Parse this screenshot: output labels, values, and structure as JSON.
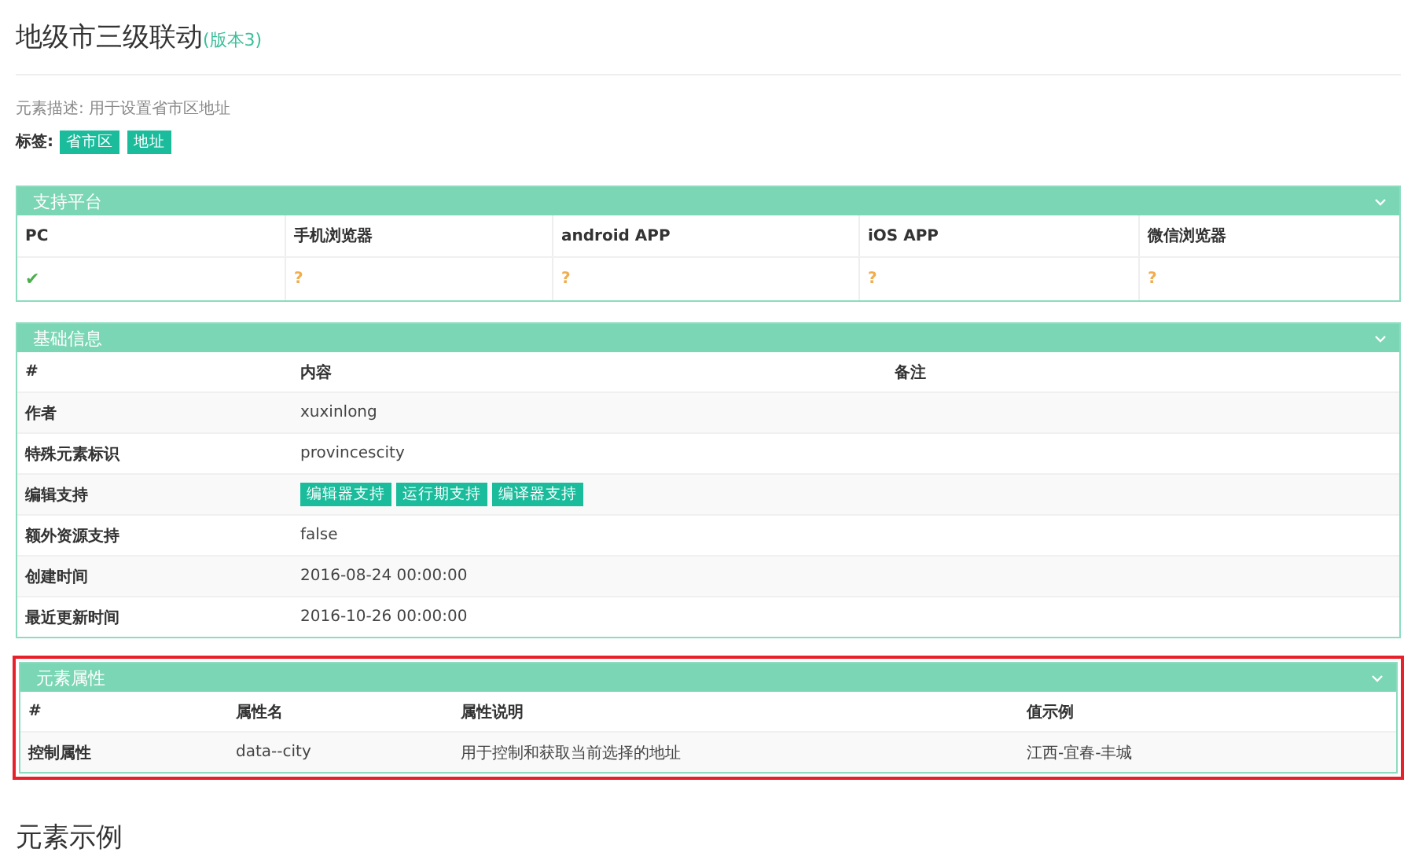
{
  "title": "地级市三级联动",
  "version": "(版本3)",
  "description": "元素描述: 用于设置省市区地址",
  "tags_label": "标签:",
  "tags": [
    "省市区",
    "地址"
  ],
  "panels": [
    {
      "kind": "platforms",
      "title": "支持平台",
      "expanded": true,
      "highlighted": false,
      "columns": [
        "PC",
        "手机浏览器",
        "android APP",
        "iOS APP",
        "微信浏览器"
      ],
      "rows": [
        {
          "cells": [
            {
              "kind": "supported",
              "text": "✔"
            },
            {
              "kind": "unknown",
              "text": "?"
            },
            {
              "kind": "unknown",
              "text": "?"
            },
            {
              "kind": "unknown",
              "text": "?"
            },
            {
              "kind": "unknown",
              "text": "?"
            }
          ]
        }
      ]
    },
    {
      "kind": "info",
      "title": "基础信息",
      "expanded": true,
      "highlighted": false,
      "columns": [
        "#",
        "内容",
        "备注"
      ],
      "rows": [
        {
          "cells": [
            {
              "kind": "label",
              "text": "作者"
            },
            {
              "kind": "text",
              "text": "xuxinlong"
            }
          ]
        },
        {
          "cells": [
            {
              "kind": "label",
              "text": "特殊元素标识"
            },
            {
              "kind": "text",
              "text": "provincescity"
            }
          ]
        },
        {
          "cells": [
            {
              "kind": "label",
              "text": "编辑支持"
            },
            {
              "kind": "tags",
              "tags": [
                "编辑器支持",
                "运行期支持",
                "编译器支持"
              ]
            }
          ]
        },
        {
          "cells": [
            {
              "kind": "label",
              "text": "额外资源支持"
            },
            {
              "kind": "text",
              "text": "false"
            }
          ]
        },
        {
          "cells": [
            {
              "kind": "label",
              "text": "创建时间"
            },
            {
              "kind": "text",
              "text": "2016-08-24 00:00:00"
            }
          ]
        },
        {
          "cells": [
            {
              "kind": "label",
              "text": "最近更新时间"
            },
            {
              "kind": "text",
              "text": "2016-10-26 00:00:00"
            }
          ]
        }
      ]
    },
    {
      "kind": "attributes",
      "title": "元素属性",
      "expanded": true,
      "highlighted": true,
      "columns": [
        "#",
        "属性名",
        "属性说明",
        "值示例"
      ],
      "rows": [
        {
          "cells": [
            {
              "kind": "label",
              "text": "控制属性"
            },
            {
              "kind": "text",
              "text": "data--city"
            },
            {
              "kind": "text",
              "text": "用于控制和获取当前选择的地址"
            },
            {
              "kind": "text",
              "text": "江西-宜春-丰城"
            }
          ]
        }
      ]
    }
  ],
  "section_title": "元素示例"
}
